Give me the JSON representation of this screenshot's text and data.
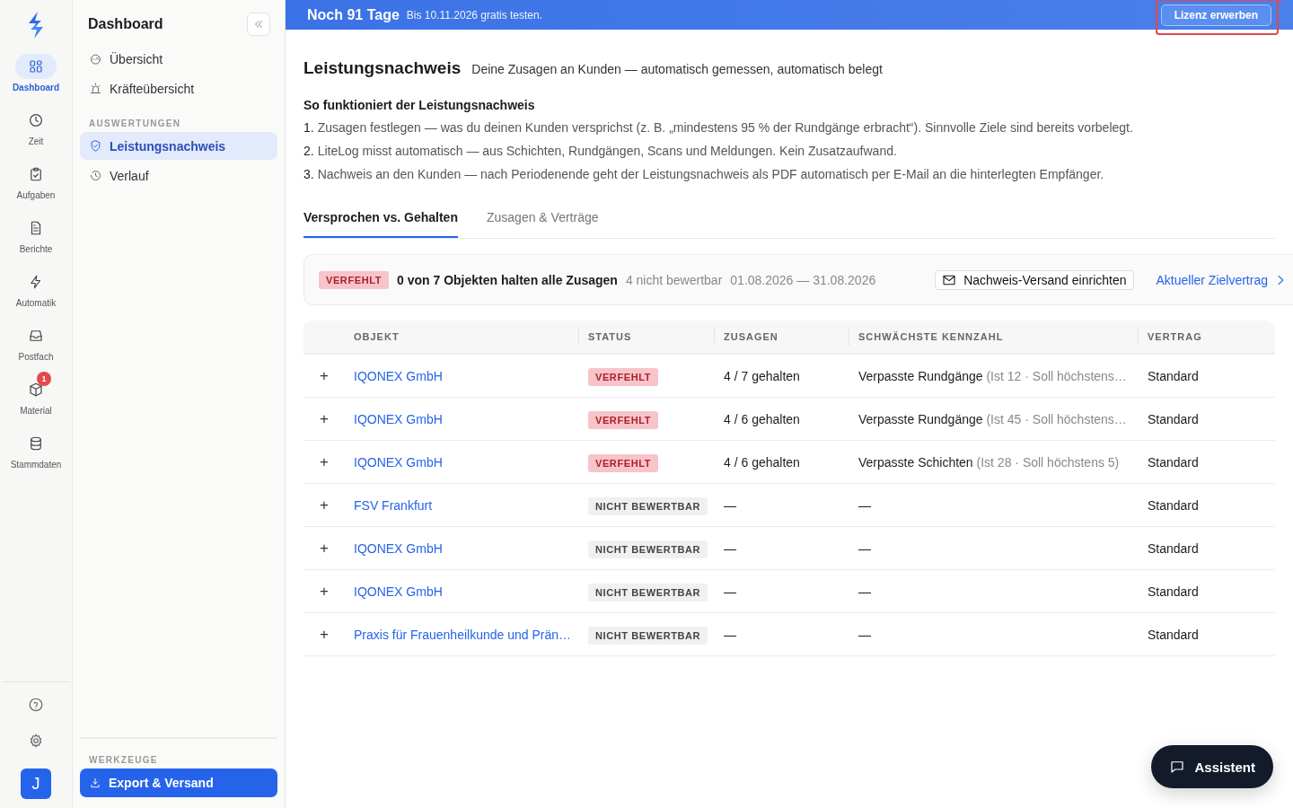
{
  "rail": {
    "items": [
      {
        "label": "Dashboard",
        "selected": true
      },
      {
        "label": "Zeit",
        "selected": false
      },
      {
        "label": "Aufgaben",
        "selected": false
      },
      {
        "label": "Berichte",
        "selected": false
      },
      {
        "label": "Automatik",
        "selected": false
      },
      {
        "label": "Postfach",
        "selected": false
      },
      {
        "label": "Material",
        "selected": false,
        "badge": "1"
      },
      {
        "label": "Stammdaten",
        "selected": false
      }
    ],
    "avatar": "J"
  },
  "sidebar": {
    "title": "Dashboard",
    "sections": [
      {
        "items": [
          {
            "label": "Übersicht",
            "selected": false
          },
          {
            "label": "Kräfteübersicht",
            "selected": false
          }
        ]
      },
      {
        "heading": "AUSWERTUNGEN",
        "items": [
          {
            "label": "Leistungsnachweis",
            "selected": true
          },
          {
            "label": "Verlauf",
            "selected": false
          }
        ]
      }
    ],
    "tools": {
      "heading": "WERKZEUGE",
      "button": "Export & Versand"
    }
  },
  "banner": {
    "title": "Noch 91 Tage",
    "subtitle": "Bis 10.11.2026 gratis testen.",
    "button": "Lizenz erwerben",
    "highlighted": true
  },
  "page": {
    "title": "Leistungsnachweis",
    "subtitle": "Deine Zusagen an Kunden — automatisch gemessen, automatisch belegt",
    "howto": {
      "title": "So funktioniert der Leistungsnachweis",
      "steps": [
        {
          "number": "1.",
          "text": "Zusagen festlegen — was du deinen Kunden versprichst (z. B. „mindestens 95 % der Rundgänge erbracht“). Sinnvolle Ziele sind bereits vorbelegt."
        },
        {
          "number": "2.",
          "text": "LiteLog misst automatisch — aus Schichten, Rundgängen, Scans und Meldungen. Kein Zusatzaufwand."
        },
        {
          "number": "3.",
          "text": "Nachweis an den Kunden — nach Periodenende geht der Leistungsnachweis als PDF automatisch per E-Mail an die hinterlegten Empfänger."
        }
      ]
    }
  },
  "tabs": [
    {
      "label": "Versprochen vs. Gehalten",
      "selected": true
    },
    {
      "label": "Zusagen & Verträge",
      "selected": false
    }
  ],
  "summary": {
    "status": "VERFEHLT",
    "headline": "0 von 7 Objekten halten alle Zusagen",
    "note": "4 nicht bewertbar",
    "period": "01.08.2026 — 31.08.2026",
    "button": "Nachweis-Versand einrichten",
    "link": "Aktueller Zielvertrag"
  },
  "table": {
    "columns": [
      "OBJEKT",
      "STATUS",
      "ZUSAGEN",
      "SCHWÄCHSTE KENNZAHL",
      "VERTRAG"
    ],
    "rows": [
      {
        "expand": "+",
        "object": "IQONEX GmbH",
        "status": {
          "label": "VERFEHLT",
          "kind": "missed"
        },
        "promises": "4 / 7 gehalten",
        "metric": "Verpasste Rundgänge",
        "metric_detail": "(Ist 12 · Soll höchstens…",
        "contract": "Standard"
      },
      {
        "expand": "+",
        "object": "IQONEX GmbH",
        "status": {
          "label": "VERFEHLT",
          "kind": "missed"
        },
        "promises": "4 / 6 gehalten",
        "metric": "Verpasste Rundgänge",
        "metric_detail": "(Ist 45 · Soll höchstens…",
        "contract": "Standard"
      },
      {
        "expand": "+",
        "object": "IQONEX GmbH",
        "status": {
          "label": "VERFEHLT",
          "kind": "missed"
        },
        "promises": "4 / 6 gehalten",
        "metric": "Verpasste Schichten",
        "metric_detail": "(Ist 28 · Soll höchstens 5)",
        "contract": "Standard"
      },
      {
        "expand": "+",
        "object": "FSV Frankfurt",
        "status": {
          "label": "NICHT BEWERTBAR",
          "kind": "na"
        },
        "promises": "—",
        "metric": "—",
        "contract": "Standard"
      },
      {
        "expand": "+",
        "object": "IQONEX GmbH",
        "status": {
          "label": "NICHT BEWERTBAR",
          "kind": "na"
        },
        "promises": "—",
        "metric": "—",
        "contract": "Standard"
      },
      {
        "expand": "+",
        "object": "IQONEX GmbH",
        "status": {
          "label": "NICHT BEWERTBAR",
          "kind": "na"
        },
        "promises": "—",
        "metric": "—",
        "contract": "Standard"
      },
      {
        "expand": "+",
        "object": "Praxis für Frauenheilkunde und Prän…",
        "status": {
          "label": "NICHT BEWERTBAR",
          "kind": "na"
        },
        "promises": "—",
        "metric": "—",
        "contract": "Standard"
      }
    ]
  },
  "assistant": {
    "label": "Assistent"
  }
}
